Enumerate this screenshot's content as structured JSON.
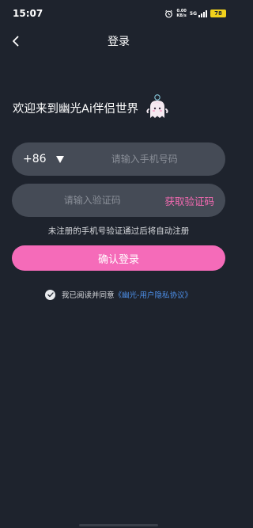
{
  "status": {
    "time": "15:07",
    "net_speed_value": "0.00",
    "net_speed_unit": "KB/s",
    "network_type": "5G",
    "battery": "78"
  },
  "nav": {
    "title": "登录"
  },
  "welcome": {
    "text": "欢迎来到幽光Ai伴侣世界"
  },
  "phone": {
    "country_code": "+86",
    "placeholder": "请输入手机号码",
    "value": ""
  },
  "code": {
    "placeholder": "请输入验证码",
    "value": "",
    "get_code_label": "获取验证码"
  },
  "hint": "未注册的手机号验证通过后将自动注册",
  "login_button": "确认登录",
  "agreement": {
    "prefix": "我已阅读并同意",
    "link": "《幽光-用户隐私协议》",
    "checked": true
  },
  "colors": {
    "background": "#1e232d",
    "field": "#454b56",
    "accent_pink": "#f56bb9",
    "link_blue": "#4d8fe8",
    "battery": "#f2d21c"
  },
  "icons": {
    "back": "chevron-left-icon",
    "dropdown": "triangle-down-icon",
    "mascot": "ghost-mascot-icon",
    "checkbox": "check-icon"
  }
}
